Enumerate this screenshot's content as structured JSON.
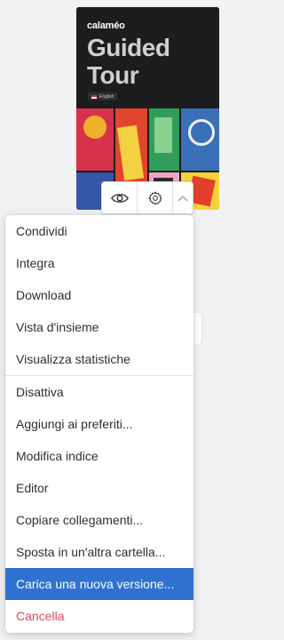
{
  "publication": {
    "brand": "calaméo",
    "title_line1": "Guided",
    "title_line2": "Tour",
    "language": "English"
  },
  "toolbar": {
    "view_icon": "eye-icon",
    "settings_icon": "gear-icon",
    "collapse_icon": "chevron-up-icon"
  },
  "menu": {
    "group1": [
      "Condividi",
      "Integra",
      "Download",
      "Vista d'insieme",
      "Visualizza statistiche"
    ],
    "group2": [
      "Disattiva",
      "Aggiungi ai preferiti...",
      "Modifica indice",
      "Editor",
      "Copiare collegamenti...",
      "Sposta in un'altra cartella..."
    ],
    "highlighted": "Carica una nuova versione...",
    "delete": "Cancella"
  },
  "colors": {
    "highlight": "#2f72d0",
    "danger": "#e2455a"
  }
}
